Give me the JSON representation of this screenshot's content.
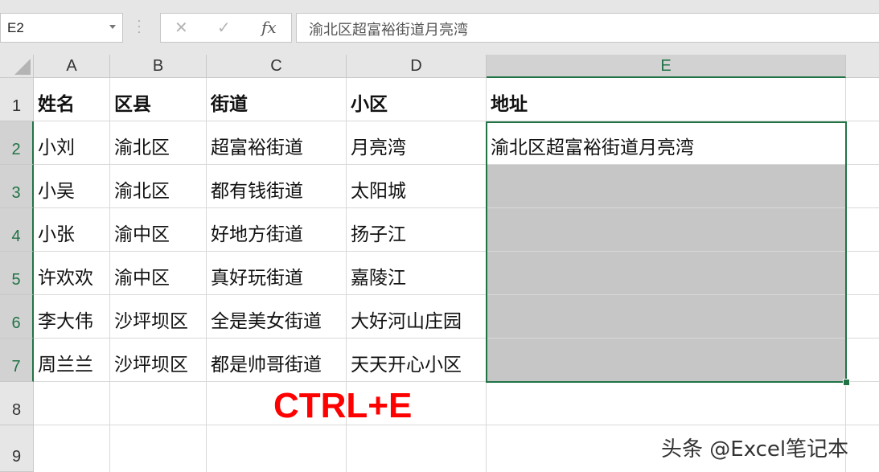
{
  "name_box": {
    "value": "E2"
  },
  "formula_bar": {
    "cancel_icon": "✕",
    "enter_icon": "✓",
    "fx_label": "fx",
    "content": "渝北区超富裕街道月亮湾"
  },
  "columns": [
    "A",
    "B",
    "C",
    "D",
    "E"
  ],
  "selected_column": "E",
  "rows": [
    "1",
    "2",
    "3",
    "4",
    "5",
    "6",
    "7",
    "8",
    "9"
  ],
  "selected_rows": [
    "2",
    "3",
    "4",
    "5",
    "6",
    "7"
  ],
  "table": {
    "headers": [
      "姓名",
      "区县",
      "街道",
      "小区",
      "地址"
    ],
    "data": [
      [
        "小刘",
        "渝北区",
        "超富裕街道",
        "月亮湾",
        "渝北区超富裕街道月亮湾"
      ],
      [
        "小吴",
        "渝北区",
        "都有钱街道",
        "太阳城",
        ""
      ],
      [
        "小张",
        "渝中区",
        "好地方街道",
        "扬子江",
        ""
      ],
      [
        "许欢欢",
        "渝中区",
        "真好玩街道",
        "嘉陵江",
        ""
      ],
      [
        "李大伟",
        "沙坪坝区",
        "全是美女街道",
        "大好河山庄园",
        ""
      ],
      [
        "周兰兰",
        "沙坪坝区",
        "都是帅哥街道",
        "天天开心小区",
        ""
      ]
    ]
  },
  "overlay_text": "CTRL+E",
  "watermark": "头条 @Excel笔记本",
  "colors": {
    "accent": "#217346",
    "selection_fill": "#c6c6c6",
    "overlay": "#ff0000"
  }
}
